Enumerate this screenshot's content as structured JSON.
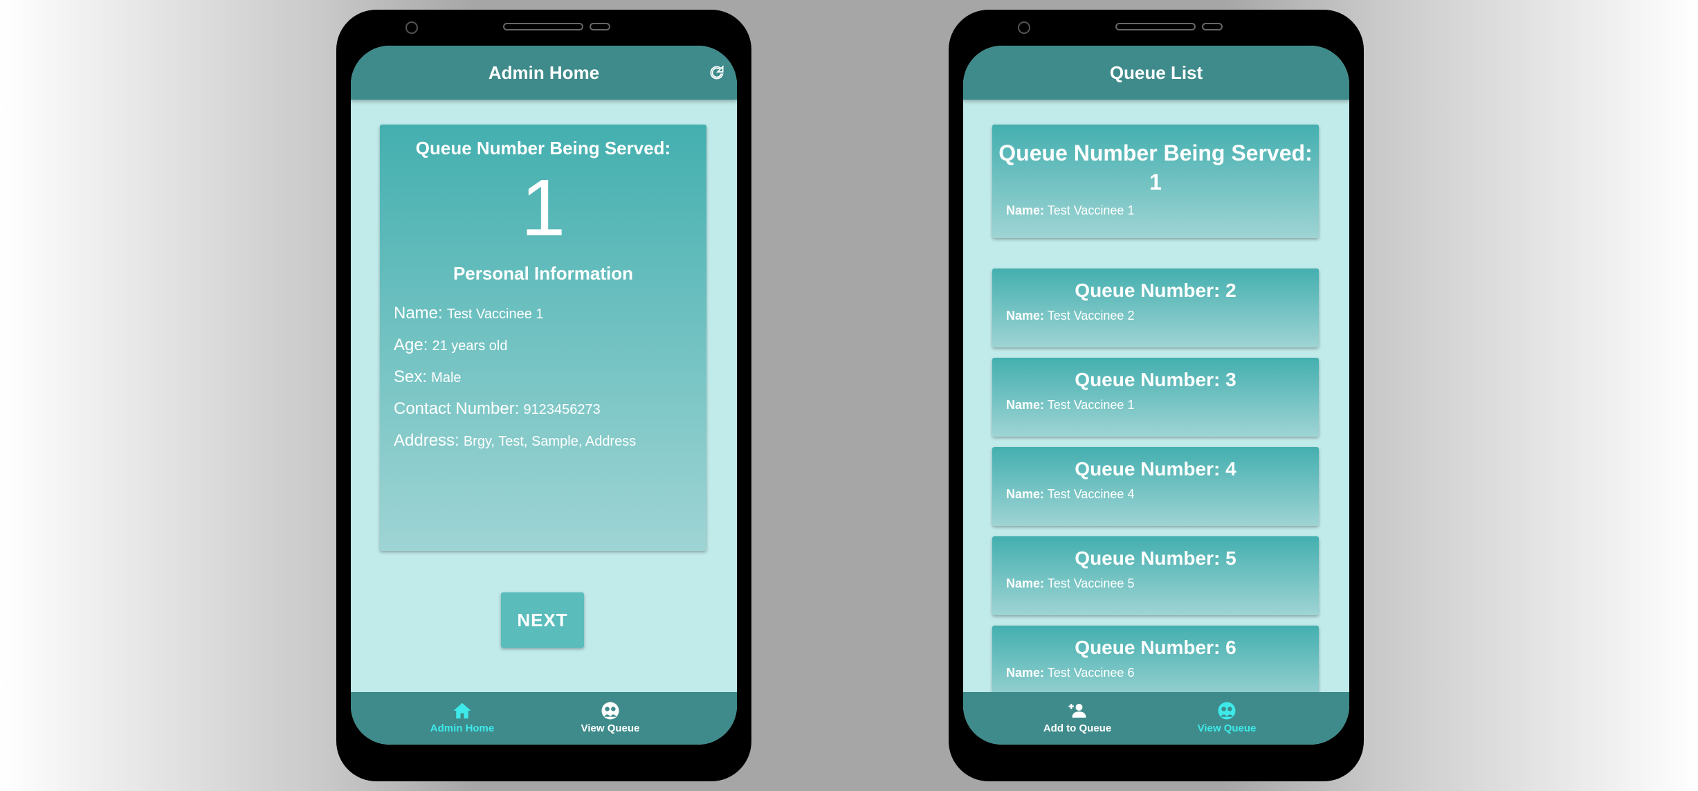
{
  "admin": {
    "title": "Admin Home",
    "serving_label": "Queue Number Being Served:",
    "serving_number": "1",
    "personal_info_title": "Personal Information",
    "fields": [
      {
        "label": "Name:",
        "value": "Test Vaccinee 1"
      },
      {
        "label": "Age:",
        "value": "21 years old"
      },
      {
        "label": "Sex:",
        "value": "Male"
      },
      {
        "label": "Contact Number:",
        "value": "9123456273"
      },
      {
        "label": "Address:",
        "value": "Brgy, Test, Sample, Address"
      }
    ],
    "next_label": "NEXT",
    "nav": [
      {
        "label": "Admin Home",
        "icon": "home-icon",
        "active": true
      },
      {
        "label": "View Queue",
        "icon": "queue-faces-icon",
        "active": false
      }
    ]
  },
  "queue": {
    "title": "Queue List",
    "serving_label": "Queue Number Being Served:",
    "serving_number": "1",
    "name_label": "Name:",
    "serving_name": "Test Vaccinee 1",
    "items": [
      {
        "label": "Queue Number: 2",
        "name": "Test Vaccinee 2"
      },
      {
        "label": "Queue Number: 3",
        "name": "Test Vaccinee 1"
      },
      {
        "label": "Queue Number: 4",
        "name": "Test Vaccinee 4"
      },
      {
        "label": "Queue Number: 5",
        "name": "Test Vaccinee 5"
      },
      {
        "label": "Queue Number: 6",
        "name": "Test Vaccinee 6"
      }
    ],
    "nav": [
      {
        "label": "Add to Queue",
        "icon": "add-person-icon",
        "active": false
      },
      {
        "label": "View Queue",
        "icon": "queue-faces-icon",
        "active": true
      }
    ]
  },
  "colors": {
    "appbar": "#3f8b8b",
    "screen_bg": "#c1eaea",
    "card_top": "#44afaf",
    "card_bottom": "#9fd4d4",
    "nav_active": "#3fe9ea"
  }
}
